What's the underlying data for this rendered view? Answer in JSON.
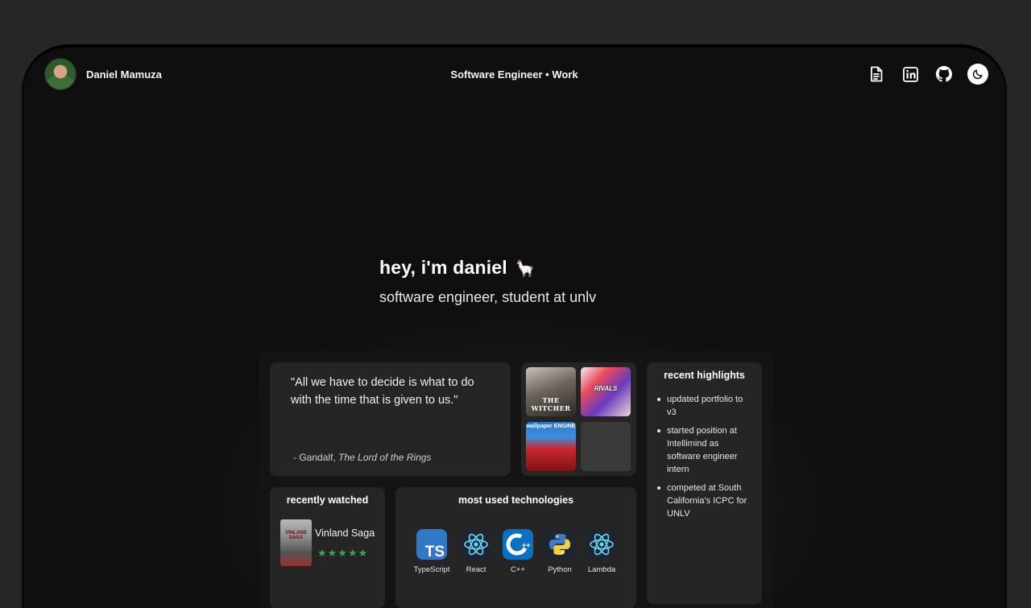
{
  "header": {
    "name": "Daniel Mamuza",
    "subtitle": "Software Engineer • Work",
    "icons": [
      "resume-document-icon",
      "linkedin-icon",
      "github-icon",
      "theme-toggle-moon-icon"
    ]
  },
  "hero": {
    "greeting": "hey, i'm daniel",
    "emoji": "🦙",
    "tagline": "software engineer, student at unlv"
  },
  "quote": {
    "text": "\"All we have to decide is what to do with the time that is given to us.\"",
    "author_prefix": "- Gandalf, ",
    "author_source": "The Lord of the Rings"
  },
  "games": [
    {
      "label": "THE WITCHER"
    },
    {
      "label": "RIVALS"
    },
    {
      "label": "wallpaper ENGINE"
    },
    {
      "label": ""
    }
  ],
  "highlights": {
    "title": "recent highlights",
    "items": [
      "updated portfolio to v3",
      "started position at Intellimind as software engineer intern",
      "competed at South California's ICPC for UNLV"
    ]
  },
  "recently_watched": {
    "title": "recently watched",
    "show": "Vinland Saga",
    "poster_text": "VINLAND SAGA",
    "rating": 5,
    "stars": "★★★★★"
  },
  "technologies": {
    "title": "most used technologies",
    "items": [
      {
        "label": "TypeScript",
        "icon": "typescript-icon"
      },
      {
        "label": "React",
        "icon": "react-icon"
      },
      {
        "label": "C++",
        "icon": "cpp-icon"
      },
      {
        "label": "Python",
        "icon": "python-icon"
      },
      {
        "label": "Lambda",
        "icon": "react-icon"
      }
    ]
  },
  "colors": {
    "background": "#0f0f0f",
    "card": "#252525",
    "star": "#3fa34d",
    "react": "#61dafb",
    "typescript": "#3178c6"
  }
}
